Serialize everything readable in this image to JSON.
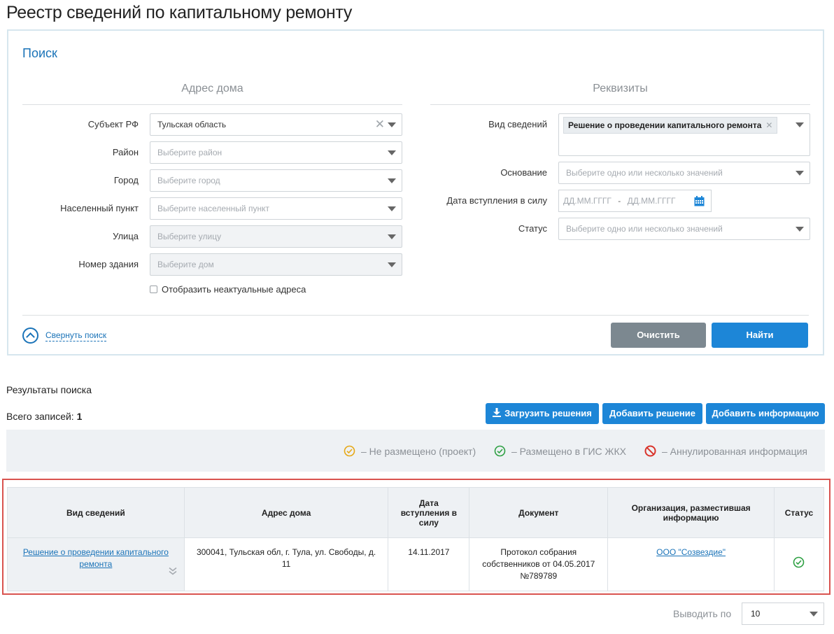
{
  "page": {
    "title": "Реестр сведений по капитальному ремонту"
  },
  "search": {
    "title": "Поиск",
    "address_section": "Адрес дома",
    "requisites_section": "Реквизиты",
    "fields": {
      "subject_label": "Субъект РФ",
      "subject_value": "Тульская область",
      "district_label": "Район",
      "district_placeholder": "Выберите район",
      "city_label": "Город",
      "city_placeholder": "Выберите город",
      "locality_label": "Населенный пункт",
      "locality_placeholder": "Выберите населенный пункт",
      "street_label": "Улица",
      "street_placeholder": "Выберите улицу",
      "building_label": "Номер здания",
      "building_placeholder": "Выберите дом",
      "show_inactive_label": "Отобразить неактуальные адреса",
      "info_type_label": "Вид сведений",
      "info_type_tag": "Решение о проведении капитального ремонта",
      "basis_label": "Основание",
      "basis_placeholder": "Выберите одно или несколько значений",
      "effective_date_label": "Дата вступления в силу",
      "date_from_placeholder": "ДД.ММ.ГГГГ",
      "date_separator": "-",
      "date_to_placeholder": "ДД.ММ.ГГГГ",
      "status_label": "Статус",
      "status_placeholder": "Выберите одно или несколько значений"
    },
    "collapse_link": "Свернуть поиск",
    "clear_button": "Очистить",
    "find_button": "Найти"
  },
  "results": {
    "title": "Результаты поиска",
    "total_label": "Всего записей:",
    "total_count": "1",
    "actions": {
      "upload": "Загрузить решения",
      "add_decision": "Добавить решение",
      "add_info": "Добавить информацию"
    },
    "legend": {
      "draft": "–  Не размещено (проект)",
      "placed": "–  Размещено в ГИС ЖКХ",
      "annulled": "–  Аннулированная информация"
    },
    "columns": [
      "Вид сведений",
      "Адрес дома",
      "Дата вступления в силу",
      "Документ",
      "Организация, разместившая информацию",
      "Статус"
    ],
    "rows": [
      {
        "info_type": "Решение о проведении капитального ремонта",
        "address": "300041, Тульская обл, г. Тула, ул. Свободы, д. 11",
        "date": "14.11.2017",
        "document": "Протокол собрания собственников от 04.05.2017 №789789",
        "organization": "ООО \"Созвездие\"",
        "status_icon": "placed-check-icon"
      }
    ],
    "per_page_label": "Выводить по",
    "per_page_value": "10"
  },
  "colors": {
    "accent": "#1d86d7",
    "link": "#1a73b8",
    "placed": "#2ea043",
    "draft": "#e6a817",
    "annulled": "#d9342b",
    "frame": "#d9534f"
  }
}
